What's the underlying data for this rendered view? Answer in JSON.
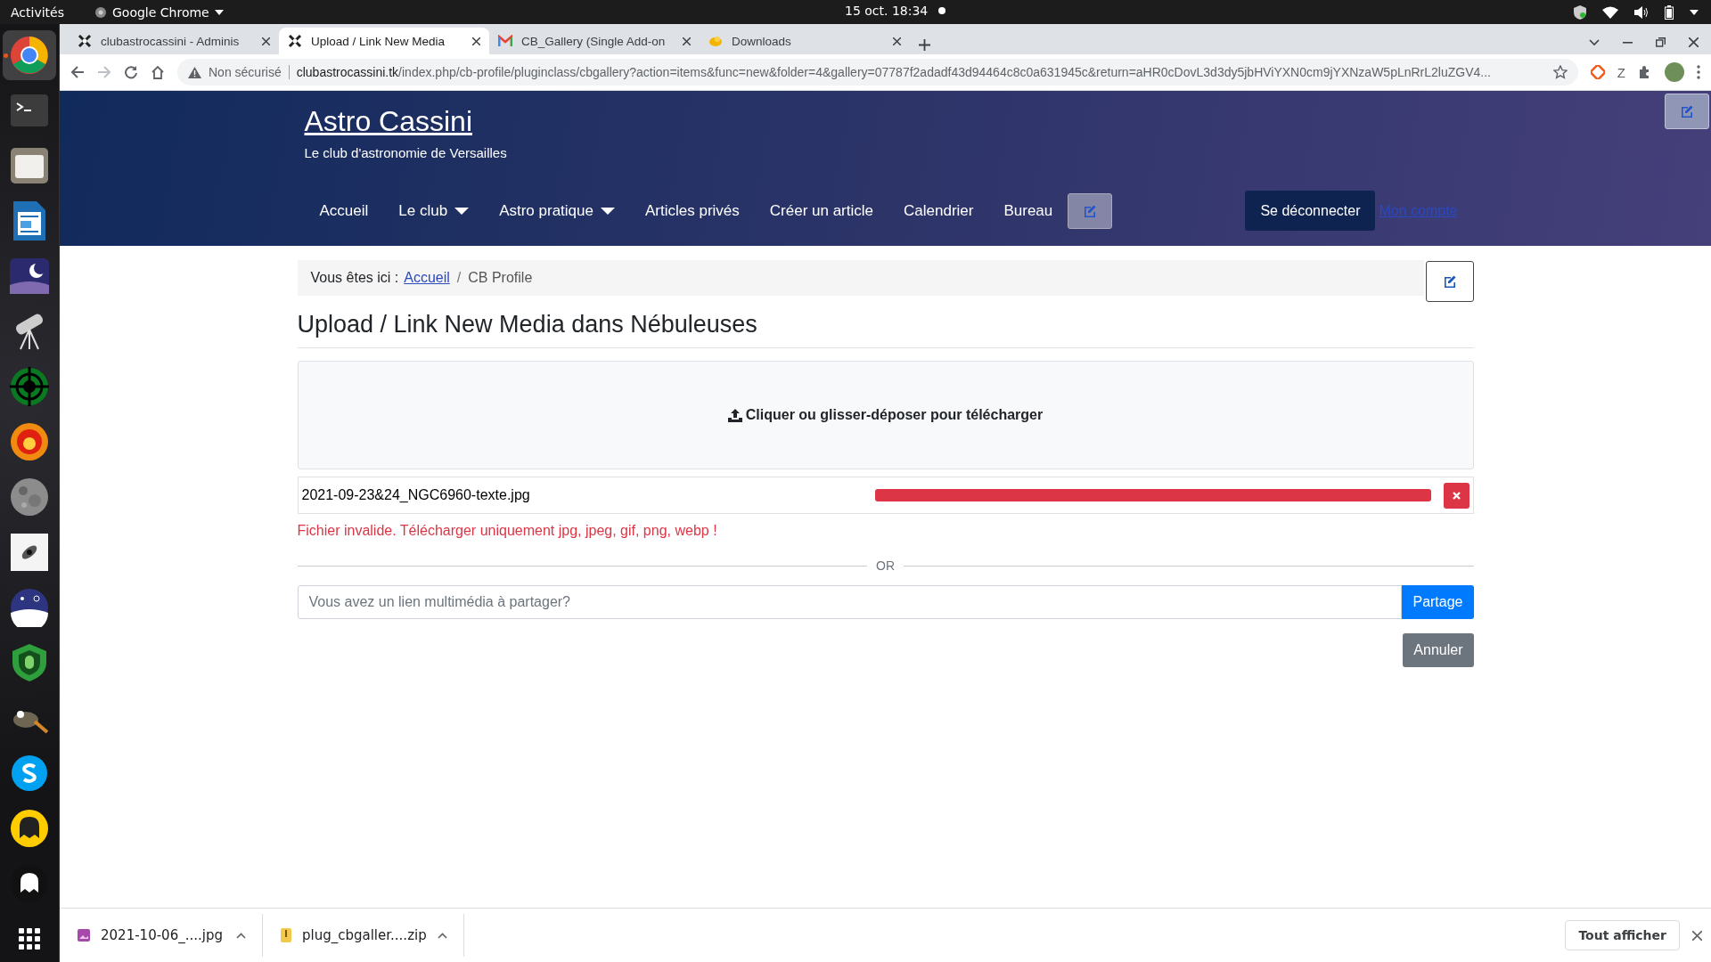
{
  "topbar": {
    "activities": "Activités",
    "app": "Google Chrome",
    "clock": "15 oct.  18:34"
  },
  "dock": [
    {
      "kind": "chrome",
      "selected": true
    },
    {
      "kind": "terminal",
      "selected": false
    },
    {
      "kind": "files",
      "selected": false
    },
    {
      "kind": "writer",
      "selected": false
    },
    {
      "kind": "nightsky",
      "selected": false
    },
    {
      "kind": "telescope",
      "selected": false
    },
    {
      "kind": "crosshair",
      "selected": false
    },
    {
      "kind": "flame",
      "selected": false
    },
    {
      "kind": "moon",
      "selected": false
    },
    {
      "kind": "galaxy",
      "selected": false
    },
    {
      "kind": "dome",
      "selected": false
    },
    {
      "kind": "shield",
      "selected": false
    },
    {
      "kind": "animal",
      "selected": false
    },
    {
      "kind": "chat",
      "selected": false
    },
    {
      "kind": "yellowghost",
      "selected": false
    },
    {
      "kind": "ghost",
      "selected": false
    }
  ],
  "browser": {
    "tabs": [
      {
        "title": "clubastrocassini - Adminis",
        "kind": "joomla",
        "selected": false
      },
      {
        "title": "Upload / Link New Media",
        "kind": "joomla",
        "selected": true
      },
      {
        "title": "CB_Gallery (Single Add-on",
        "kind": "mail",
        "selected": false
      },
      {
        "title": "Downloads",
        "kind": "site",
        "selected": false
      }
    ],
    "security": "Non sécurisé",
    "host": "clubastrocassini.tk",
    "path": "/index.php/cb-profile/pluginclass/cbgallery?action=items&func=new&folder=4&gallery=07787f2adadf43d94464c8c0a631945c&return=aHR0cDovL3d3dy5jbHViYXN0cm9jYXNzaW5pLnRrL2luZGV4...",
    "extension_letter": "Z"
  },
  "site": {
    "title": "Astro Cassini",
    "tagline": "Le club d'astronomie de Versailles",
    "nav": [
      {
        "label": "Accueil",
        "dropdown": false
      },
      {
        "label": "Le club",
        "dropdown": true
      },
      {
        "label": "Astro pratique",
        "dropdown": true
      },
      {
        "label": "Articles privés",
        "dropdown": false
      },
      {
        "label": "Créer un article",
        "dropdown": false
      },
      {
        "label": "Calendrier",
        "dropdown": false
      },
      {
        "label": "Bureau",
        "dropdown": false
      }
    ],
    "logout": "Se déconnecter",
    "account": "Mon compte"
  },
  "breadcrumb": {
    "prefix": "Vous êtes ici :",
    "separator": "/",
    "items": [
      {
        "label": "Accueil",
        "link": true
      },
      {
        "label": "CB Profile",
        "link": false
      }
    ]
  },
  "heading": "Upload / Link New Media dans Nébuleuses",
  "dropzone": "Cliquer ou glisser-déposer pour télécharger",
  "files": [
    {
      "name": "2021-09-23&24_NGC6960-texte.jpg",
      "level": 1,
      "error": true
    }
  ],
  "error_message": "Fichier invalide. Télécharger uniquement jpg, jpeg, gif, png, webp !",
  "divider": "OR",
  "link": {
    "placeholder": "Vous avez un lien multimédia à partager?",
    "button": "Partage"
  },
  "cancel": "Annuler",
  "downloads": [
    {
      "name": "2021-10-06_....jpg",
      "kind": "image"
    },
    {
      "name": "plug_cbgaller....zip",
      "kind": "archive"
    }
  ],
  "show_all": "Tout afficher"
}
